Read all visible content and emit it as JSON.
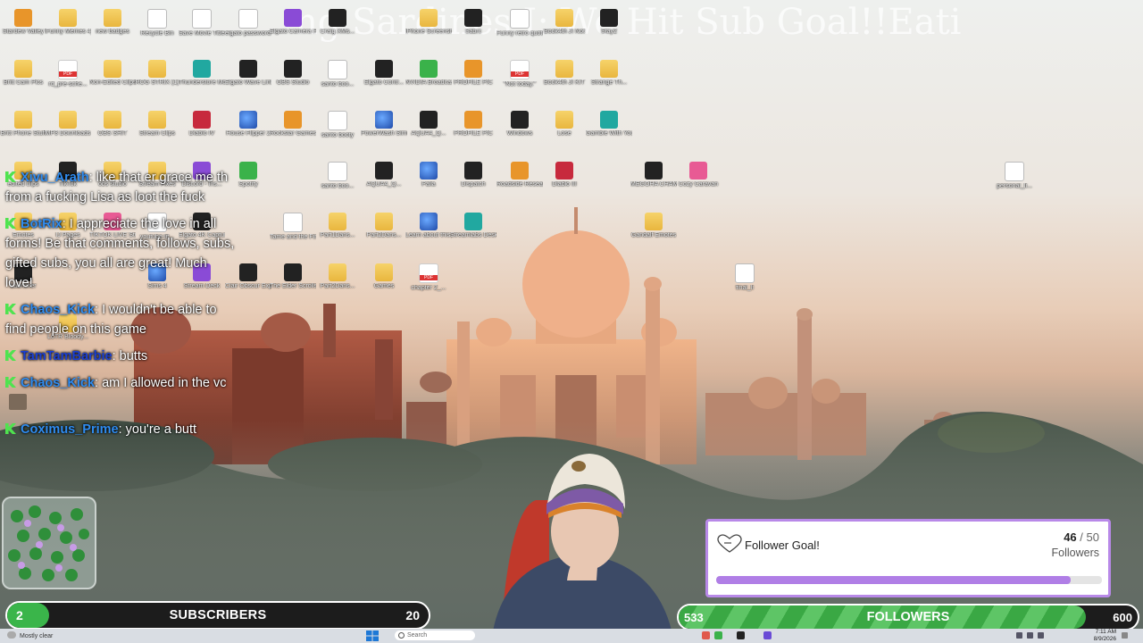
{
  "stream_title": "ng Sardines I: We Hit Sub Goal!!Eati",
  "desktop_icons": [
    {
      "label": "Stardew Valley",
      "kind": "g-orange"
    },
    {
      "label": "iFunny Memes 4_SH",
      "kind": "g-folder"
    },
    {
      "label": "new badges",
      "kind": "g-folder"
    },
    {
      "label": "Recycle Bin",
      "kind": "g-doc"
    },
    {
      "label": "Save Movie Titles",
      "kind": "g-doc"
    },
    {
      "label": "elgato password...",
      "kind": "g-doc"
    },
    {
      "label": "Elgato Camera Hub",
      "kind": "g-purple"
    },
    {
      "label": "Craig XMs...",
      "kind": "g-dark"
    },
    {
      "label": "iPhone Screenshot...",
      "kind": "g-folder"
    },
    {
      "label": "Sabrc",
      "kind": "g-dark"
    },
    {
      "label": "Funny retro quotes",
      "kind": "g-doc"
    },
    {
      "label": "Book4th JI Not",
      "kind": "g-folder"
    },
    {
      "label": "Stay2",
      "kind": "g-dark"
    },
    {
      "label": "Britt Cam Pics",
      "kind": "g-folder"
    },
    {
      "label": "rd_pre-sche...",
      "kind": "g-pdf"
    },
    {
      "label": "Non-Edited Clips",
      "kind": "g-folder"
    },
    {
      "label": "ROG STRIX (1)",
      "kind": "g-folder"
    },
    {
      "label": "Thunderstore Mod Mana...",
      "kind": "g-teal"
    },
    {
      "label": "Elgato Wave Link",
      "kind": "g-dark"
    },
    {
      "label": "OBS Studio",
      "kind": "g-dark"
    },
    {
      "label": "santo boo...",
      "kind": "g-doc"
    },
    {
      "label": "Elgato Contr...",
      "kind": "g-dark"
    },
    {
      "label": "NVIDIA Broadcast",
      "kind": "g-green"
    },
    {
      "label": "PROFILE PIC",
      "kind": "g-orange"
    },
    {
      "label": "\"Not today.\"",
      "kind": "g-pdf"
    },
    {
      "label": "Book4th JI KIT",
      "kind": "g-folder"
    },
    {
      "label": "Strange Th...",
      "kind": "g-folder"
    },
    {
      "label": "Britt Phone Stuff",
      "kind": "g-folder"
    },
    {
      "label": "MP3 Downloads",
      "kind": "g-folder"
    },
    {
      "label": "OBS SHIT",
      "kind": "g-folder"
    },
    {
      "label": "Stream Clips",
      "kind": "g-folder"
    },
    {
      "label": "Diablo IV",
      "kind": "g-red"
    },
    {
      "label": "House Flipper 2",
      "kind": "g-app"
    },
    {
      "label": "Rockstar Games ...",
      "kind": "g-orange"
    },
    {
      "label": "santo booty",
      "kind": "g-doc"
    },
    {
      "label": "PowerWash Simulator 2",
      "kind": "g-app"
    },
    {
      "label": "AQUA4_Q...",
      "kind": "g-dark"
    },
    {
      "label": "PROFILE PIC",
      "kind": "g-orange"
    },
    {
      "label": "Windows",
      "kind": "g-dark"
    },
    {
      "label": "Lose",
      "kind": "g-folder"
    },
    {
      "label": "Gamble With Your Friends",
      "kind": "g-teal"
    },
    {
      "label": "edited clips",
      "kind": "g-folder"
    },
    {
      "label": "TikTok",
      "kind": "g-dark"
    },
    {
      "label": "obs studio",
      "kind": "g-folder"
    },
    {
      "label": "Stream Fixes",
      "kind": "g-folder"
    },
    {
      "label": "Discord - Ins...",
      "kind": "g-purple"
    },
    {
      "label": "Spotify",
      "kind": "g-green"
    },
    {
      "label": "santo boo...",
      "kind": "g-doc"
    },
    {
      "label": "AQUA4_Q...",
      "kind": "g-dark"
    },
    {
      "label": "Palia",
      "kind": "g-app"
    },
    {
      "label": "Dispatch",
      "kind": "g-dark"
    },
    {
      "label": "Roadside Research",
      "kind": "g-orange"
    },
    {
      "label": "Diablo III",
      "kind": "g-red"
    },
    {
      "label": "MEGOHA CHAMELEON",
      "kind": "g-dark"
    },
    {
      "label": "Cozy Caravan",
      "kind": "g-pink"
    },
    {
      "label": "personal_li...",
      "kind": "g-doc"
    },
    {
      "label": "Emotes",
      "kind": "g-folder"
    },
    {
      "label": "IJ Pages",
      "kind": "g-folder"
    },
    {
      "label": "TIKTOK LIVE Studio",
      "kind": "g-pink"
    },
    {
      "label": "youtube-lit...",
      "kind": "g-doc"
    },
    {
      "label": "Elgato 4K Capture...",
      "kind": "g-dark"
    },
    {
      "label": "Tame and the Firefighter's...",
      "kind": "g-doc"
    },
    {
      "label": "Part1Dans...",
      "kind": "g-folder"
    },
    {
      "label": "Part2Dans...",
      "kind": "g-folder"
    },
    {
      "label": "Learn about this picture",
      "kind": "g-app"
    },
    {
      "label": "Streamlabs Desktop",
      "kind": "g-teal"
    },
    {
      "label": "Gandalf Emotes",
      "kind": "g-folder"
    },
    {
      "label": "Launcher",
      "kind": "g-dark"
    },
    {
      "label": "Sims 4",
      "kind": "g-app"
    },
    {
      "label": "Stream Deck",
      "kind": "g-purple"
    },
    {
      "label": "Clair Obscur Expedition 33",
      "kind": "g-dark"
    },
    {
      "label": "The Elder Scrolls IV...",
      "kind": "g-dark"
    },
    {
      "label": "Part2Dans...",
      "kind": "g-folder"
    },
    {
      "label": "Games",
      "kind": "g-folder"
    },
    {
      "label": "chapter 2_...",
      "kind": "g-pdf"
    },
    {
      "label": "final_li",
      "kind": "g-doc"
    },
    {
      "label": "LoTR Bloody...",
      "kind": "g-folder"
    }
  ],
  "chat": [
    {
      "user": "Xivu_Arath",
      "color": "#2f8cf0",
      "text": "like that er grace me th from a fucking Lisa as loot the fuck"
    },
    {
      "user": "BotRix",
      "color": "#2f8cf0",
      "text": "I appreciate the love in all forms! Be that comments, follows, subs, gifted subs, you all are great! Much love!"
    },
    {
      "user": "Chaos_Kick",
      "color": "#2f8cf0",
      "text": "I wouldn't be able to find people on this game"
    },
    {
      "user": "TamTamBarbie",
      "color": "#1b3fd1",
      "text": "butts"
    },
    {
      "user": "Chaos_Kick",
      "color": "#2f8cf0",
      "text": "am I allowed in the vc",
      "emote": true
    },
    {
      "user": "Coximus_Prime",
      "color": "#2f8cf0",
      "text": "you're a butt"
    }
  ],
  "follower_goal": {
    "title": "Follower Goal!",
    "current": "46",
    "separator": "/",
    "target": "50",
    "unit": "Followers",
    "progress": 0.92,
    "accent": "#b07ee6"
  },
  "subscribers_bar": {
    "current": "2",
    "label": "SUBSCRIBERS",
    "goal": "20",
    "progress": 0.1,
    "accent": "#3ab54a"
  },
  "followers_bar": {
    "current": "533",
    "label": "FOLLOWERS",
    "goal": "600",
    "progress": 0.888,
    "accent": "#3aa844"
  },
  "taskbar": {
    "weather": "Mostly clear",
    "search_placeholder": "Search",
    "time": "7:11 AM",
    "date": "8/9/2026"
  }
}
